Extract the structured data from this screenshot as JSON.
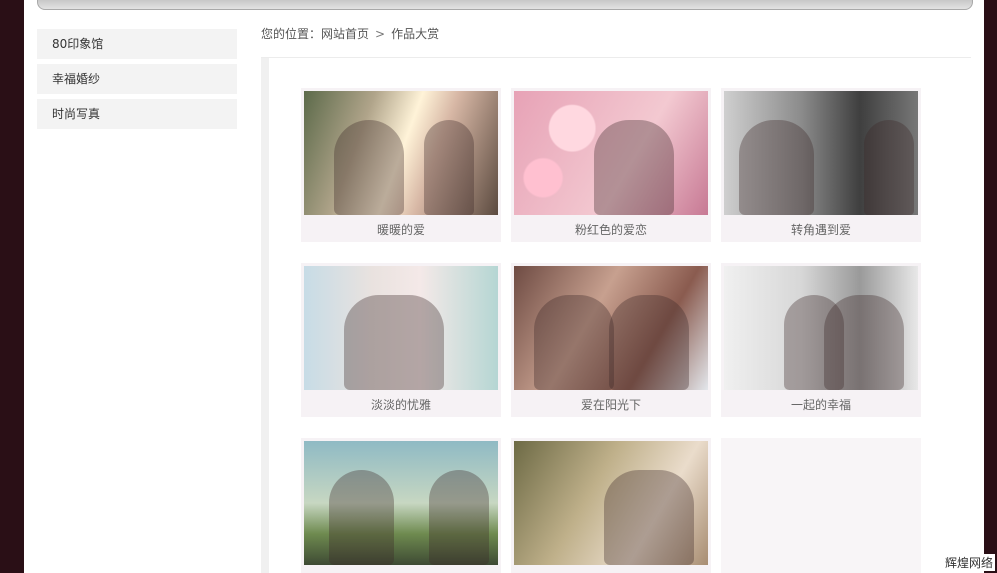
{
  "sidebar": {
    "items": [
      {
        "label": "80印象馆"
      },
      {
        "label": "幸福婚纱"
      },
      {
        "label": "时尚写真"
      }
    ]
  },
  "breadcrumb": {
    "prefix": "您的位置：",
    "home": "网站首页",
    "separator": ">",
    "current": "作品大赏"
  },
  "gallery": {
    "items": [
      {
        "caption": "暖暖的爱"
      },
      {
        "caption": "粉红色的爱恋"
      },
      {
        "caption": "转角遇到爱"
      },
      {
        "caption": "淡淡的忧雅"
      },
      {
        "caption": "爱在阳光下"
      },
      {
        "caption": "一起的幸福"
      },
      {
        "caption": ""
      },
      {
        "caption": ""
      }
    ]
  },
  "watermark": "辉煌网络"
}
